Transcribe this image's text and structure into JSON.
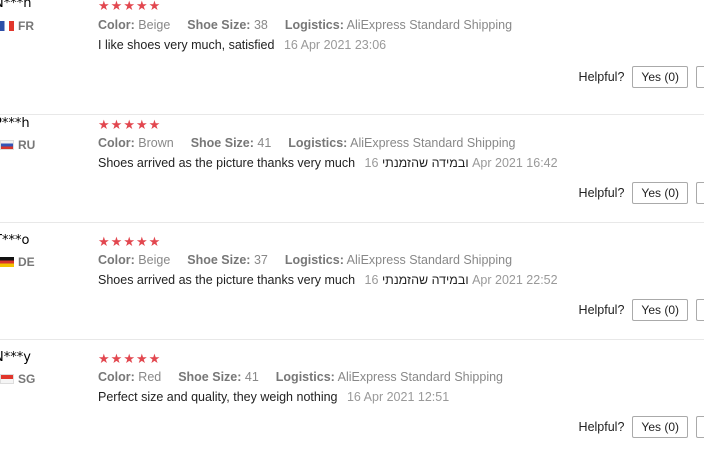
{
  "reviews": [
    {
      "user": "N***h",
      "country": "FR",
      "rating": 5,
      "color_label": "Color:",
      "color": "Beige",
      "size_label": "Shoe Size:",
      "size": "38",
      "logistics_label": "Logistics:",
      "logistics": "AliExpress Standard Shipping",
      "text": "I like shoes very much, satisfied",
      "date": "16 Apr 2021 23:06",
      "helpful_label": "Helpful?",
      "yes_label": "Yes (0)"
    },
    {
      "user": "P***h",
      "country": "RU",
      "rating": 5,
      "color_label": "Color:",
      "color": "Brown",
      "size_label": "Shoe Size:",
      "size": "41",
      "logistics_label": "Logistics:",
      "logistics": "AliExpress Standard Shipping",
      "text": "Shoes arrived as the picture thanks very much ובמידה שהזמנתי",
      "date": "16 Apr 2021 16:42",
      "helpful_label": "Helpful?",
      "yes_label": "Yes (0)"
    },
    {
      "user": "T***o",
      "country": "DE",
      "rating": 5,
      "color_label": "Color:",
      "color": "Beige",
      "size_label": "Shoe Size:",
      "size": "37",
      "logistics_label": "Logistics:",
      "logistics": "AliExpress Standard Shipping",
      "text": "Shoes arrived as the picture thanks very much ובמידה שהזמנתי",
      "date": "16 Apr 2021 22:52",
      "helpful_label": "Helpful?",
      "yes_label": "Yes (0)"
    },
    {
      "user": "N***y",
      "country": "SG",
      "rating": 5,
      "color_label": "Color:",
      "color": "Red",
      "size_label": "Shoe Size:",
      "size": "41",
      "logistics_label": "Logistics:",
      "logistics": "AliExpress Standard Shipping",
      "text": "Perfect size and quality, they weigh nothing",
      "date": "16 Apr 2021 12:51",
      "helpful_label": "Helpful?",
      "yes_label": "Yes (0)"
    }
  ],
  "colors": {
    "star": "#e2474f",
    "muted": "#888888",
    "border": "#e8e8e8"
  },
  "icons": {
    "star": "star-icon"
  }
}
